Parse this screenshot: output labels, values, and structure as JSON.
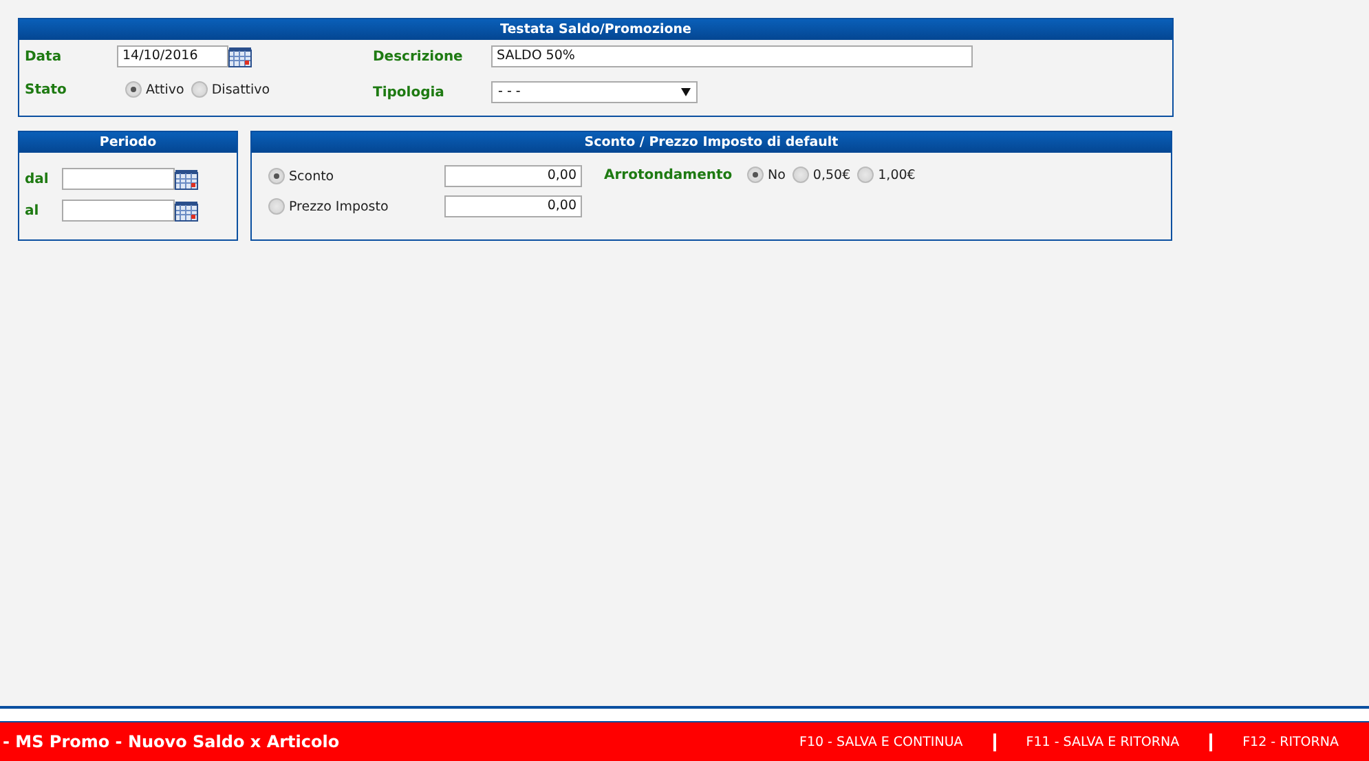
{
  "header_panel": {
    "title": "Testata Saldo/Promozione",
    "date": {
      "label": "Data",
      "value": "14/10/2016"
    },
    "description": {
      "label": "Descrizione",
      "value": "SALDO 50%"
    },
    "status": {
      "label": "Stato",
      "options": [
        {
          "label": "Attivo",
          "selected": true
        },
        {
          "label": "Disattivo",
          "selected": false
        }
      ]
    },
    "type": {
      "label": "Tipologia",
      "value": "- - -"
    }
  },
  "period_panel": {
    "title": "Periodo",
    "fields": [
      {
        "label": "dal"
      },
      {
        "label": "al"
      }
    ]
  },
  "discount_panel": {
    "title": "Sconto / Prezzo Imposto di default",
    "modes": [
      {
        "label": "Sconto",
        "selected": true,
        "value": "0,00"
      },
      {
        "label": "Prezzo Imposto",
        "selected": false,
        "value": "0,00"
      }
    ],
    "rounding": {
      "label": "Arrotondamento",
      "options": [
        {
          "label": "No",
          "selected": true
        },
        {
          "label": "0,50€",
          "selected": false
        },
        {
          "label": "1,00€",
          "selected": false
        }
      ]
    }
  },
  "footer": {
    "title": "- MS Promo - Nuovo Saldo x Articolo",
    "actions": [
      "F10 - SALVA E CONTINUA",
      "F11 - SALVA E RITORNA",
      "F12 - RITORNA"
    ]
  }
}
